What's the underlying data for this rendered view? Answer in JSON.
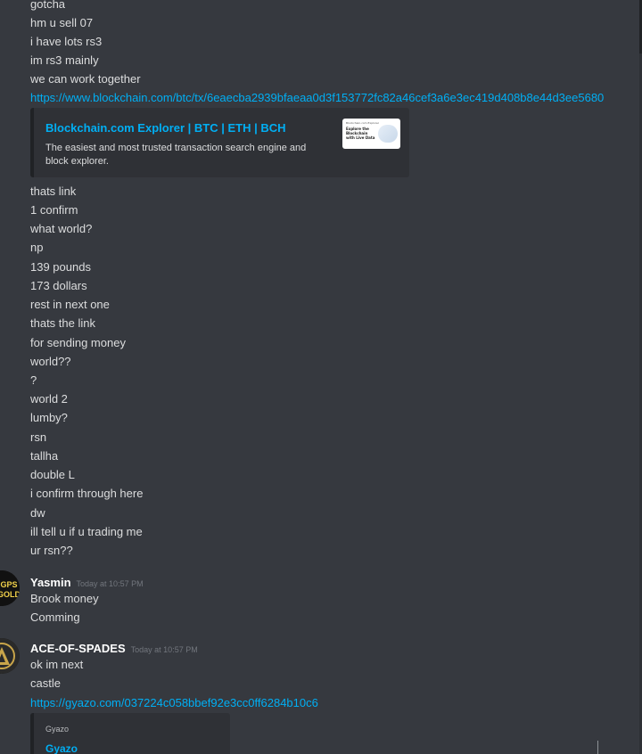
{
  "messages_top": [
    "gotcha",
    "hm u sell 07",
    "i have lots rs3",
    "im rs3 mainly",
    "we can work together"
  ],
  "blockchain_link": "https://www.blockchain.com/btc/tx/6eaecba2939bfaeaa0d3f153772fc82a46cef3a6e3ec419d408b8e44d3ee5680",
  "embed1": {
    "title": "Blockchain.com Explorer | BTC | ETH | BCH",
    "description": "The easiest and most trusted transaction search engine and block explorer.",
    "thumb_top": "Blockchain.com   Explorer",
    "thumb_heading": "Explore the Blockchain with Live Data"
  },
  "messages_mid": [
    "thats link",
    "1 confirm",
    "what world?",
    "np",
    "139 pounds",
    "173 dollars",
    "rest in next one",
    "thats the link",
    "for sending money",
    "world??",
    "?",
    "world 2",
    "lumby?",
    "rsn",
    "tallha",
    "double L",
    "i confirm through here",
    "dw",
    "ill tell u if u trading me",
    "ur rsn??"
  ],
  "yasmin": {
    "name": "Yasmin",
    "time": "Today at 10:57 PM",
    "avatar_text": "GPS GOLD",
    "messages": [
      "Brook money",
      "Comming"
    ]
  },
  "ace": {
    "name": "ACE-OF-SPADES",
    "time": "Today at 10:57 PM",
    "avatar_glyph": "A",
    "messages": [
      "ok im next",
      "castle"
    ],
    "link": "https://gyazo.com/037224c058bbef92e3cc0ff6284b10c6"
  },
  "embed2": {
    "provider": "Gyazo",
    "title": "Gyazo"
  },
  "colors": {
    "background": "#36393f",
    "link": "#00aff4",
    "embed_bg": "#2f3136",
    "text": "#dcddde"
  }
}
